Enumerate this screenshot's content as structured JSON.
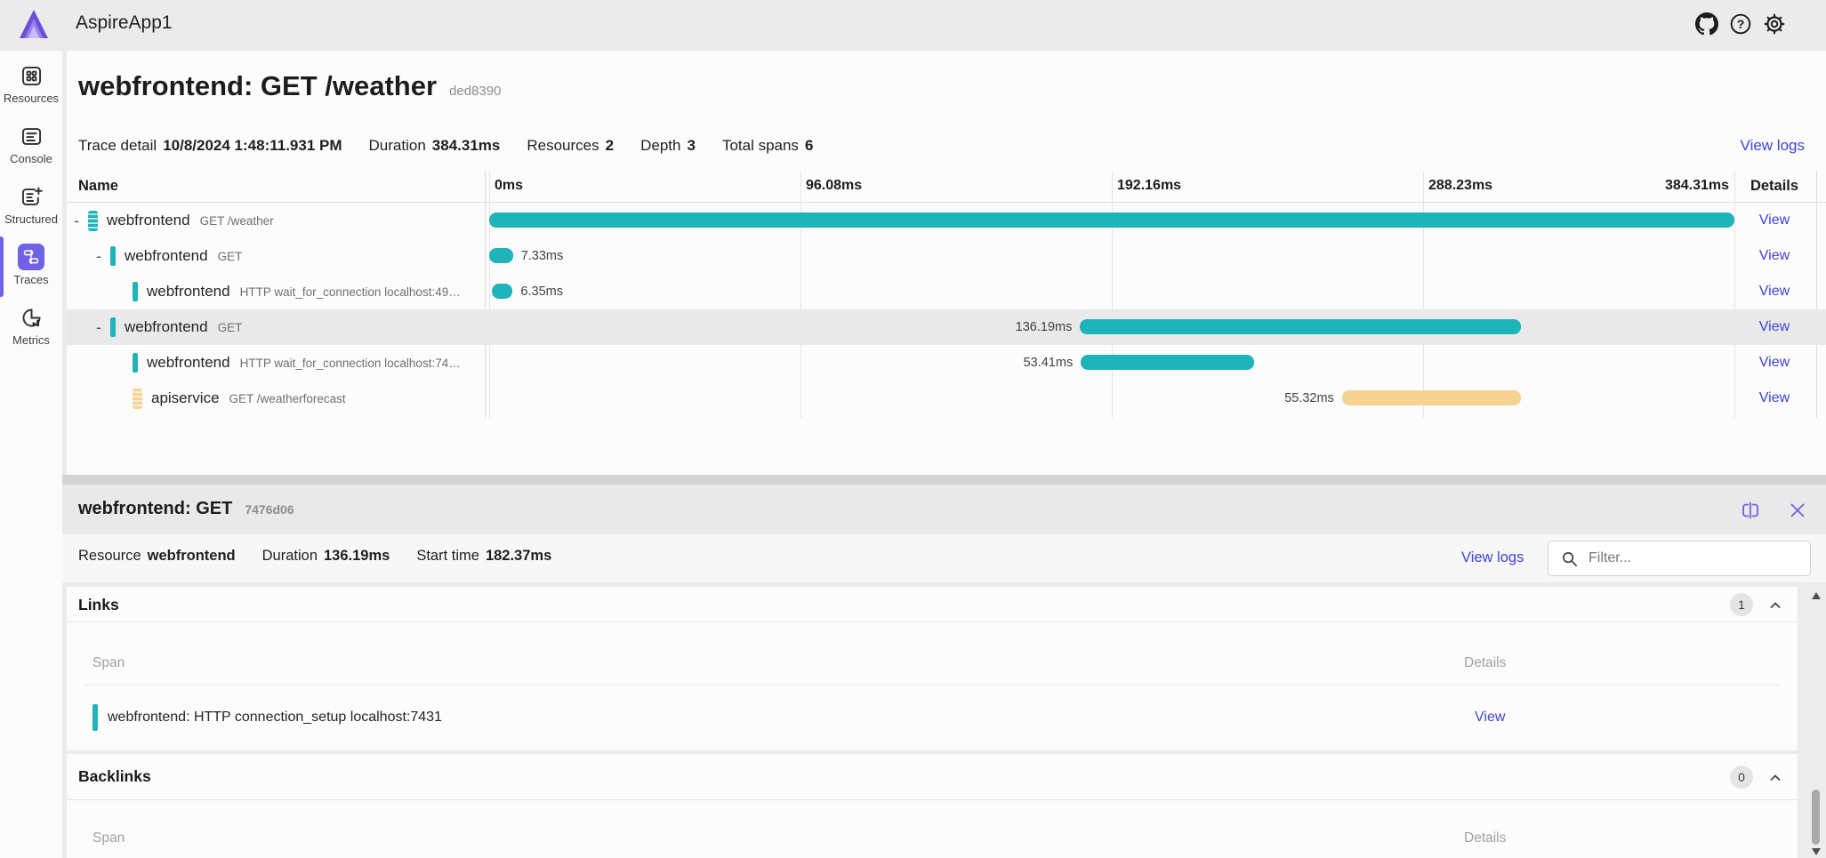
{
  "topbar": {
    "title": "AspireApp1"
  },
  "sidebar": {
    "items": [
      {
        "label": "Resources",
        "icon": "resources-grid-icon",
        "active": false
      },
      {
        "label": "Console",
        "icon": "console-icon",
        "active": false
      },
      {
        "label": "Structured",
        "icon": "structured-logs-icon",
        "active": false
      },
      {
        "label": "Traces",
        "icon": "traces-icon",
        "active": true
      },
      {
        "label": "Metrics",
        "icon": "metrics-icon",
        "active": false
      }
    ]
  },
  "trace_header": {
    "title": "webfrontend: GET /weather",
    "trace_id": "ded8390"
  },
  "trace_summary": {
    "trace_detail_label": "Trace detail",
    "timestamp": "10/8/2024 1:48:11.931 PM",
    "duration_label": "Duration",
    "duration": "384.31ms",
    "resources_label": "Resources",
    "resources": "2",
    "depth_label": "Depth",
    "depth": "3",
    "total_spans_label": "Total spans",
    "total_spans": "6",
    "view_logs_label": "View logs"
  },
  "trace_table": {
    "name_header": "Name",
    "details_header": "Details",
    "total_ms": 384.31,
    "ticks": [
      "0ms",
      "96.08ms",
      "192.16ms",
      "288.23ms",
      "384.31ms"
    ],
    "rows": [
      {
        "resource": "webfrontend",
        "label": "GET /weather",
        "indent": 0,
        "expander": "-",
        "icon": "striped",
        "color": "teal",
        "start_ms": 0,
        "duration_ms": 384.31,
        "duration_label": "",
        "label_side": "none",
        "selected": false,
        "details_label": "View"
      },
      {
        "resource": "webfrontend",
        "label": "GET",
        "indent": 1,
        "expander": "-",
        "icon": "bar",
        "color": "teal",
        "start_ms": 0,
        "duration_ms": 7.33,
        "duration_label": "7.33ms",
        "label_side": "right",
        "selected": false,
        "details_label": "View"
      },
      {
        "resource": "webfrontend",
        "label": "HTTP wait_for_connection localhost:49…",
        "indent": 2,
        "expander": "",
        "icon": "bar",
        "color": "teal",
        "start_ms": 0.9,
        "duration_ms": 6.35,
        "duration_label": "6.35ms",
        "label_side": "right",
        "selected": false,
        "details_label": "View"
      },
      {
        "resource": "webfrontend",
        "label": "GET",
        "indent": 1,
        "expander": "-",
        "icon": "bar",
        "color": "teal",
        "start_ms": 182.37,
        "duration_ms": 136.19,
        "duration_label": "136.19ms",
        "label_side": "left",
        "selected": true,
        "details_label": "View"
      },
      {
        "resource": "webfrontend",
        "label": "HTTP wait_for_connection localhost:74…",
        "indent": 2,
        "expander": "",
        "icon": "bar",
        "color": "teal",
        "start_ms": 182.6,
        "duration_ms": 53.41,
        "duration_label": "53.41ms",
        "label_side": "left",
        "selected": false,
        "details_label": "View"
      },
      {
        "resource": "apiservice",
        "label": "GET /weatherforecast",
        "indent": 2,
        "expander": "",
        "icon": "striped",
        "color": "yellow",
        "start_ms": 263.2,
        "duration_ms": 55.32,
        "duration_label": "55.32ms",
        "label_side": "left",
        "selected": false,
        "details_label": "View"
      }
    ]
  },
  "span_panel": {
    "title": "webfrontend: GET",
    "span_id": "7476d06",
    "resource_label": "Resource",
    "resource": "webfrontend",
    "duration_label": "Duration",
    "duration": "136.19ms",
    "start_time_label": "Start time",
    "start_time": "182.37ms",
    "view_logs_label": "View logs",
    "filter_placeholder": "Filter...",
    "links": {
      "title": "Links",
      "count": "1",
      "span_header": "Span",
      "details_header": "Details",
      "rows": [
        {
          "text": "webfrontend: HTTP connection_setup localhost:7431",
          "details_label": "View"
        }
      ]
    },
    "backlinks": {
      "title": "Backlinks",
      "count": "0",
      "span_header": "Span",
      "details_header": "Details"
    }
  },
  "colors": {
    "accent_purple": "#7160e8",
    "link_blue": "#4141d8",
    "teal": "#1fb4ba",
    "yellow": "#f6d392"
  }
}
